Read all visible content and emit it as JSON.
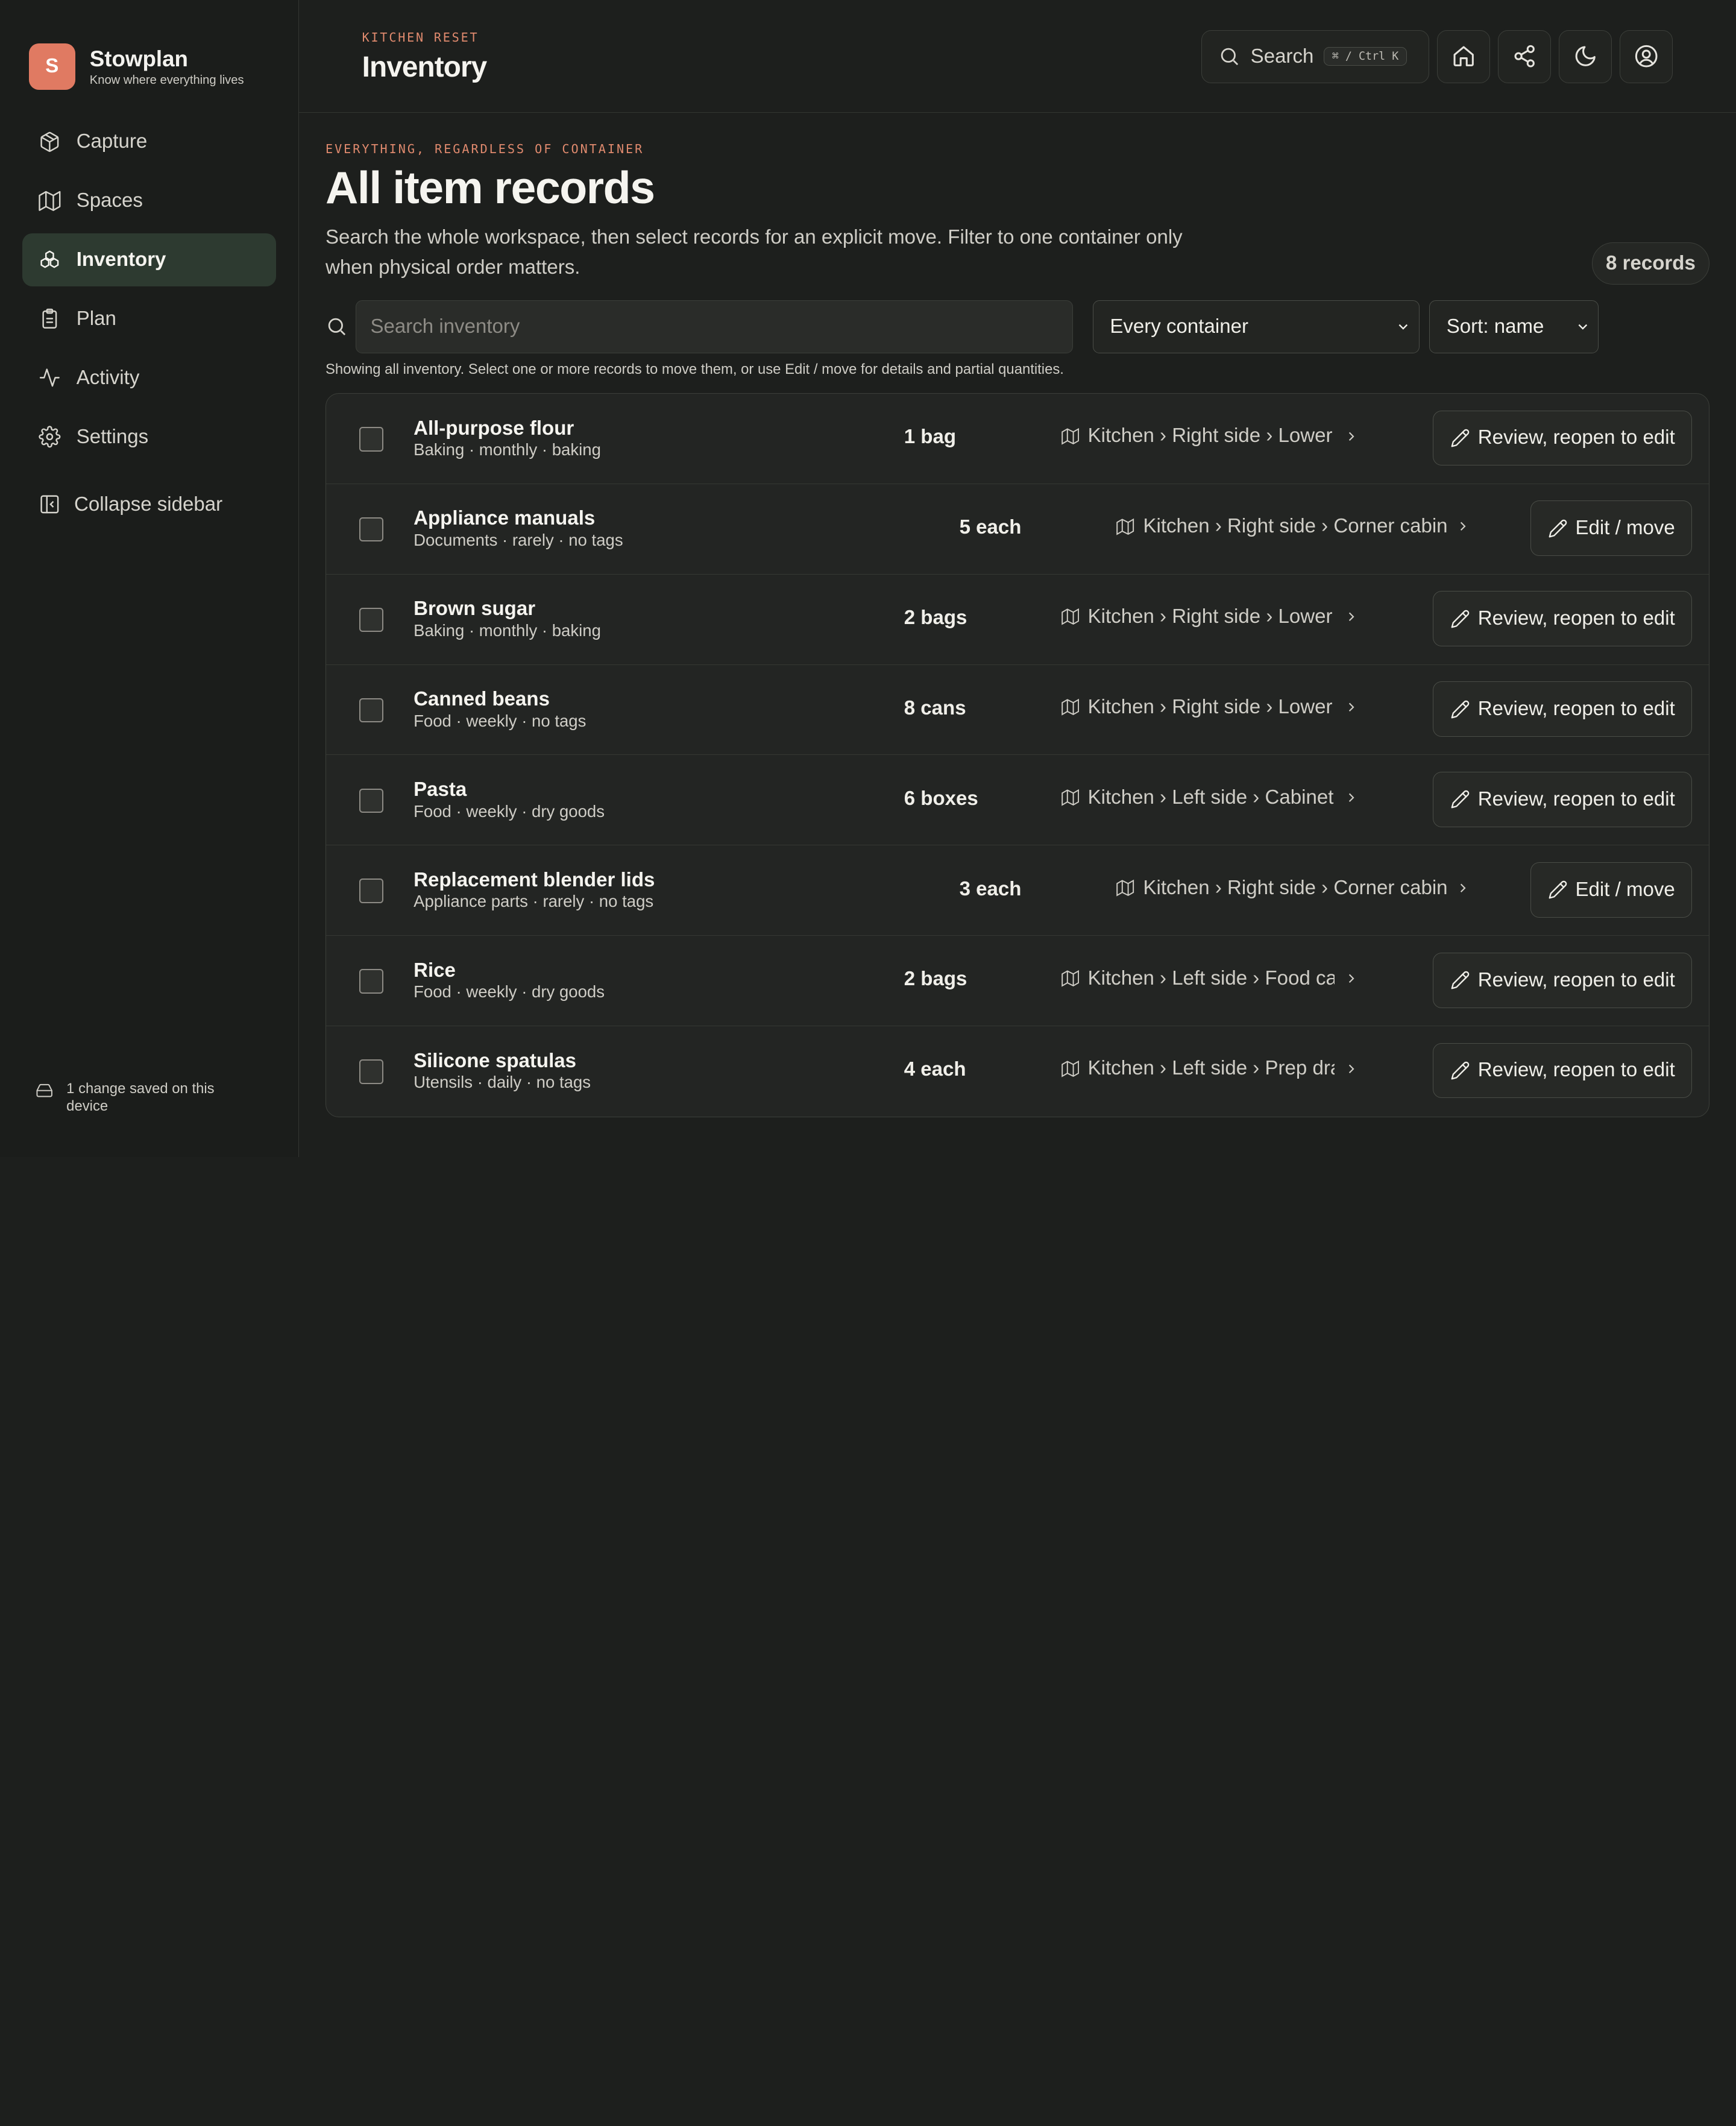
{
  "brand": {
    "initial": "S",
    "name": "Stowplan",
    "tagline": "Know where everything lives"
  },
  "nav": [
    {
      "key": "capture",
      "label": "Capture",
      "icon": "package-icon"
    },
    {
      "key": "spaces",
      "label": "Spaces",
      "icon": "map-icon"
    },
    {
      "key": "inventory",
      "label": "Inventory",
      "icon": "boxes-icon",
      "active": true
    },
    {
      "key": "plan",
      "label": "Plan",
      "icon": "clipboard-icon"
    },
    {
      "key": "activity",
      "label": "Activity",
      "icon": "activity-icon"
    },
    {
      "key": "settings",
      "label": "Settings",
      "icon": "gear-icon"
    }
  ],
  "collapse_label": "Collapse sidebar",
  "sync_status": "1 change saved on this device",
  "header": {
    "crumb": "KITCHEN RESET",
    "title": "Inventory",
    "search_label": "Search",
    "search_shortcut": "⌘ / Ctrl K"
  },
  "page": {
    "eyebrow": "EVERYTHING, REGARDLESS OF CONTAINER",
    "title": "All item records",
    "description": "Search the whole workspace, then select records for an explicit move. Filter to one container only when physical order matters.",
    "count": "8 records",
    "search_placeholder": "Search inventory",
    "container_filter": "Every container",
    "sort": "Sort: name",
    "hint": "Showing all inventory. Select one or more records to move them, or use Edit / move for details and partial quantities."
  },
  "items": [
    {
      "name": "All-purpose flour",
      "meta": "Baking · monthly · baking",
      "qty": "1 bag",
      "location": "Kitchen › Right side › Lower cabinet",
      "action": "Review, reopen to edit",
      "reviewed": true
    },
    {
      "name": "Appliance manuals",
      "meta": "Documents · rarely · no tags",
      "qty": "5 each",
      "location": "Kitchen › Right side › Corner cabinet › …",
      "action": "Edit / move",
      "reviewed": false
    },
    {
      "name": "Brown sugar",
      "meta": "Baking · monthly · baking",
      "qty": "2 bags",
      "location": "Kitchen › Right side › Lower cabinet",
      "action": "Review, reopen to edit",
      "reviewed": true
    },
    {
      "name": "Canned beans",
      "meta": "Food · weekly · no tags",
      "qty": "8 cans",
      "location": "Kitchen › Right side › Lower cabinet",
      "action": "Review, reopen to edit",
      "reviewed": true
    },
    {
      "name": "Pasta",
      "meta": "Food · weekly · dry goods",
      "qty": "6 boxes",
      "location": "Kitchen › Left side › Cabinet above",
      "action": "Review, reopen to edit",
      "reviewed": true
    },
    {
      "name": "Replacement blender lids",
      "meta": "Appliance parts · rarely · no tags",
      "qty": "3 each",
      "location": "Kitchen › Right side › Corner cabinet › …",
      "action": "Edit / move",
      "reviewed": false
    },
    {
      "name": "Rice",
      "meta": "Food · weekly · dry goods",
      "qty": "2 bags",
      "location": "Kitchen › Left side › Food cabinet",
      "action": "Review, reopen to edit",
      "reviewed": true
    },
    {
      "name": "Silicone spatulas",
      "meta": "Utensils · daily · no tags",
      "qty": "4 each",
      "location": "Kitchen › Left side › Prep drawer",
      "action": "Review, reopen to edit",
      "reviewed": true
    }
  ]
}
